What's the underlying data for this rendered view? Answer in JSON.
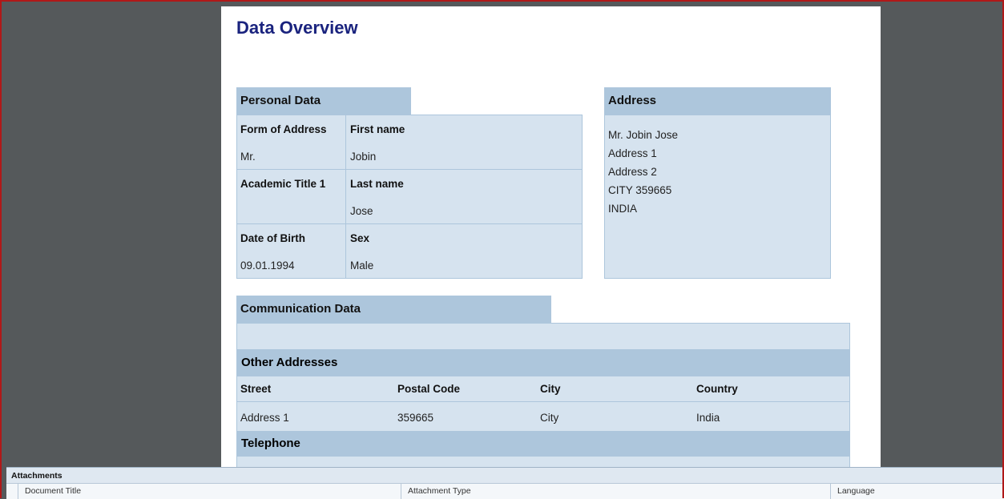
{
  "page_title": "Data Overview",
  "personal": {
    "header": "Personal Data",
    "form_of_address_label": "Form of Address",
    "form_of_address": "Mr.",
    "first_name_label": "First name",
    "first_name": "Jobin",
    "academic_title_label": "Academic Title 1",
    "academic_title": "",
    "last_name_label": "Last name",
    "last_name": "Jose",
    "dob_label": "Date of Birth",
    "dob": "09.01.1994",
    "sex_label": "Sex",
    "sex": "Male"
  },
  "address": {
    "header": "Address",
    "lines": [
      "Mr. Jobin Jose",
      "Address 1",
      "Address 2",
      "CITY 359665",
      "INDIA"
    ]
  },
  "communication": {
    "header": "Communication Data",
    "other_addresses_header": "Other Addresses",
    "columns": [
      "Street",
      "Postal Code",
      "City",
      "Country"
    ],
    "rows": [
      [
        "Address 1",
        "359665",
        "City",
        "India"
      ]
    ],
    "telephone_header": "Telephone"
  },
  "attachments": {
    "title": "Attachments",
    "columns": [
      "Document Title",
      "Attachment Type",
      "Language"
    ]
  }
}
